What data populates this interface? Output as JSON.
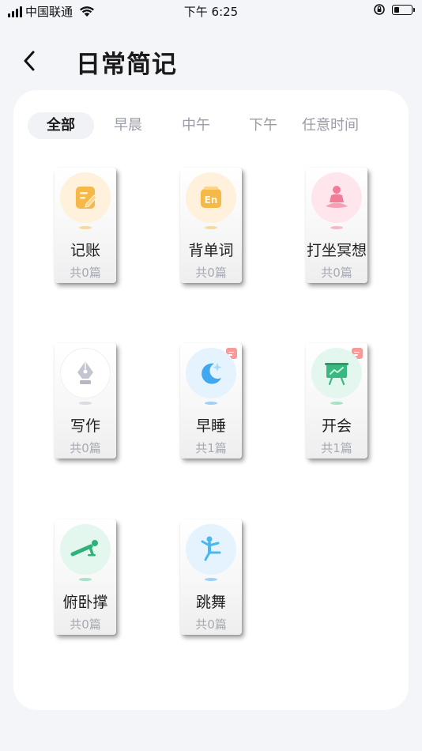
{
  "status_bar": {
    "carrier": "中国联通",
    "time": "下午 6:25"
  },
  "header": {
    "title": "日常简记"
  },
  "tabs": [
    {
      "label": "全部",
      "active": true
    },
    {
      "label": "早晨",
      "active": false
    },
    {
      "label": "中午",
      "active": false
    },
    {
      "label": "下午",
      "active": false
    },
    {
      "label": "任意时间",
      "active": false
    }
  ],
  "items": [
    {
      "name": "记账",
      "count": "共0篇",
      "icon": "edit-note-icon",
      "bg": "#fff1dc",
      "accent": "#f7b84a",
      "badge": false
    },
    {
      "name": "背单词",
      "count": "共0篇",
      "icon": "english-word-icon",
      "bg": "#fff1dc",
      "accent": "#f7b84a",
      "badge": false
    },
    {
      "name": "打坐冥想",
      "count": "共0篇",
      "icon": "meditation-icon",
      "bg": "#ffe6ec",
      "accent": "#f27b97",
      "badge": false
    },
    {
      "name": "写作",
      "count": "共0篇",
      "icon": "pen-nib-icon",
      "bg": "#ffffff",
      "accent": "#b5b8c4",
      "badge": false
    },
    {
      "name": "早睡",
      "count": "共1篇",
      "icon": "moon-icon",
      "bg": "#e4f3fd",
      "accent": "#3fa8ef",
      "badge": true
    },
    {
      "name": "开会",
      "count": "共1篇",
      "icon": "presentation-board-icon",
      "bg": "#e4f7ee",
      "accent": "#39b980",
      "badge": true
    },
    {
      "name": "俯卧撑",
      "count": "共0篇",
      "icon": "push-up-icon",
      "bg": "#e4f7ee",
      "accent": "#2fb27a",
      "badge": false
    },
    {
      "name": "跳舞",
      "count": "共0篇",
      "icon": "dance-icon",
      "bg": "#e4f3fd",
      "accent": "#48b8ef",
      "badge": false
    }
  ]
}
